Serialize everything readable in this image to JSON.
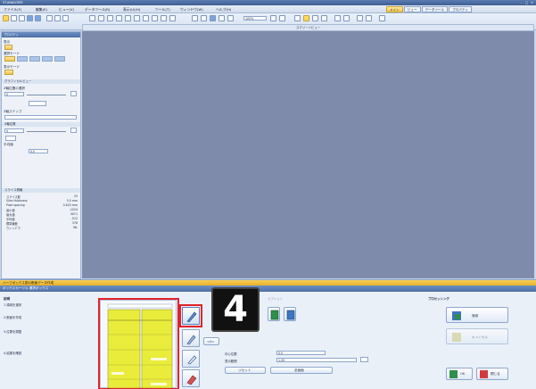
{
  "window": {
    "title": "ST-ANALYZER"
  },
  "menu": [
    "ファイル(F)",
    "編集(E)",
    "ビュー(V)",
    "データツール(R)",
    "表示(U)(H)",
    "ツール(T)",
    "ウィンドウ(W)",
    "ヘルプ(H)"
  ],
  "ribbon_tabs": [
    "メイン",
    "ビュー",
    "データツール",
    "プロパティ"
  ],
  "toolbar": {
    "zoom_value": "100%"
  },
  "left_panel": {
    "title": "プロパティ",
    "items": [
      {
        "label": "表示"
      },
      {
        "label": "選択モード"
      },
      {
        "label": "表示モード"
      },
      {
        "label": "グラフィカルビュー"
      },
      {
        "label": "Z軸位置の選択"
      },
      {
        "label": "Z軸ステップ"
      },
      {
        "label": "Z軸位置"
      },
      {
        "label": "平均値"
      }
    ],
    "field_values": [
      "0",
      "0",
      "0.0"
    ],
    "stats_header": "スライス情報",
    "stats": [
      {
        "k": "スライス数",
        "v": "25"
      },
      {
        "k": "Slice thickness",
        "v": "5.0 mm"
      },
      {
        "k": "Pixel spacing",
        "v": "0.625 mm"
      },
      {
        "k": "最小値",
        "v": "-1024"
      },
      {
        "k": "最大値",
        "v": "3071"
      },
      {
        "k": "平均値",
        "v": "-512"
      },
      {
        "k": "標準偏差",
        "v": "378"
      },
      {
        "k": "ウィンドウ",
        "v": "WL"
      }
    ]
  },
  "canvas": {
    "title": "スクリーンビュー"
  },
  "bottom_panel": {
    "header": "ハーフボックス型の断面データ作成",
    "subheader": "ボックスカーソル 選択ボックス",
    "desc_label": "説明",
    "desc_lines": [
      "1.領域を選択",
      "2.断面を作成",
      "3.位置を調整",
      "4.結果を確認"
    ],
    "step_badge": "4",
    "options_caption": "オプション",
    "arrow_label": "<0>",
    "field1_label": "中心位置",
    "field2_label": "表示範囲",
    "field1_val": "0.0",
    "field2_val": "1.00",
    "btn_a": "リセット",
    "btn_b": "全画面",
    "right_caption": "プロセッシング",
    "apply_label": "適用",
    "cancel_label": "キャンセル",
    "ok_label": "OK",
    "close_label": "閉じる"
  }
}
